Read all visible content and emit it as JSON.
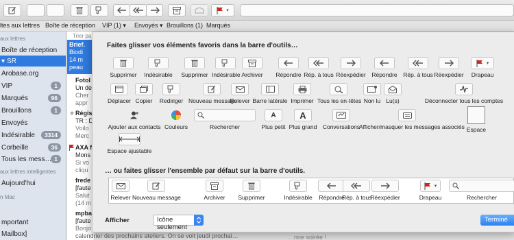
{
  "toolbar": {
    "buttons": [
      {
        "icon": "compose-icon"
      },
      {
        "icon": "blank"
      },
      {
        "icon": "blank"
      },
      {
        "icon": "trash-icon"
      },
      {
        "icon": "thumbs-down-icon"
      },
      {
        "icon": "reply-icon"
      },
      {
        "icon": "reply-all-icon"
      },
      {
        "icon": "forward-icon"
      },
      {
        "icon": "archive-icon"
      },
      {
        "icon": "mailbox-icon"
      },
      {
        "icon": "flag-icon"
      }
    ]
  },
  "favorites": {
    "items": [
      "ltes aux lettres",
      "Boîte de réception",
      "VIP (1)",
      "Envoyés",
      "Brouillons (1)",
      "Marqués"
    ],
    "vip_chevron": "▾",
    "envoyes_chevron": "▾"
  },
  "sidebar": {
    "header1": "aux lettres",
    "items": [
      {
        "label": "Boîte de réception",
        "badge": ""
      },
      {
        "label": "SR",
        "badge": "",
        "selected": true
      },
      {
        "label": "Arobase.org",
        "badge": ""
      },
      {
        "label": "VIP",
        "badge": "1"
      },
      {
        "label": "Marqués",
        "badge": "96"
      },
      {
        "label": "Brouillons",
        "badge": "1"
      },
      {
        "label": "Envoyés",
        "badge": ""
      },
      {
        "label": "Indésirable",
        "badge": "3314"
      },
      {
        "label": "Corbeille",
        "badge": "36"
      },
      {
        "label": "Tous les mess…",
        "badge": "1"
      }
    ],
    "header2": "aux lettres intelligentes",
    "smart": "Aujourd'hui",
    "header3": "n Mac",
    "mac": [
      "mportant",
      "Mailbox]"
    ]
  },
  "list": {
    "sort": "Trier pa",
    "rows": [
      {
        "l1": "Brief.",
        "l2": "Biodi",
        "l3": "14 m",
        "l4": "peau"
      },
      {
        "l1": "Fotol",
        "l2": "Un de",
        "l3": "Cher",
        "l4": "appr"
      },
      {
        "l1": "Régis",
        "l2": "TR : D",
        "l3": "Voilo",
        "l4": "Merc"
      },
      {
        "l1": "AXA f",
        "l2": "Mons",
        "l3": "Si vo",
        "l4": "cliqu"
      },
      {
        "l1": "frede",
        "l2": "[faute",
        "l3": "Salut",
        "l4": "(14 m"
      },
      {
        "l1": "mpba",
        "l2": "[faute",
        "l3": "Bonjo",
        "l4": ""
      }
    ],
    "footer": "calendrier des prochains ateliers. On se voit jeudi prochai…",
    "bottom": "…nne soirée !"
  },
  "sheet": {
    "title": "Faites glisser vos éléments favoris dans la barre d'outils…",
    "row1": [
      {
        "label": "Supprimer",
        "icon": "trash-icon"
      },
      {
        "label": "Indésirable",
        "icon": "thumbs-down-icon"
      },
      {
        "label": "Supprimer",
        "icon": "trash-icon"
      },
      {
        "label": "Indésirable",
        "icon": "thumbs-down-icon"
      },
      {
        "label": "Archiver",
        "icon": "archive-icon"
      },
      {
        "label": "Répondre",
        "icon": "reply-icon"
      },
      {
        "label": "Rép. à tous",
        "icon": "reply-all-icon"
      },
      {
        "label": "Réexpédier",
        "icon": "forward-icon"
      },
      {
        "label": "Répondre",
        "icon": "reply-icon"
      },
      {
        "label": "Rép. à tous",
        "icon": "reply-all-icon"
      },
      {
        "label": "Réexpédier",
        "icon": "forward-icon"
      },
      {
        "label": "Drapeau",
        "icon": "flag-icon"
      }
    ],
    "row2": [
      {
        "label": "Déplacer",
        "icon": "move-icon"
      },
      {
        "label": "Copier",
        "icon": "copy-icon"
      },
      {
        "label": "Rediriger",
        "icon": "redirect-icon"
      },
      {
        "label": "Nouveau message",
        "icon": "compose-icon"
      },
      {
        "label": "Relever",
        "icon": "mail-icon"
      },
      {
        "label": "Barre latérale",
        "icon": "sidebar-icon"
      },
      {
        "label": "Imprimer",
        "icon": "printer-icon"
      },
      {
        "label": "Tous les en-têtes",
        "icon": "headers-icon"
      },
      {
        "label": "Non lu",
        "icon": "unread-icon"
      },
      {
        "label": "Lu(s)",
        "icon": "read-icon"
      },
      {
        "label": "Déconnecter tous les comptes",
        "icon": "activity-icon"
      }
    ],
    "row3": [
      {
        "label": "Ajouter aux contacts",
        "icon": "add-contact-icon"
      },
      {
        "label": "Couleurs",
        "icon": "color-wheel-icon"
      },
      {
        "label": "Rechercher",
        "icon": "search-icon"
      },
      {
        "label": "Plus petit",
        "icon": "font-small-icon"
      },
      {
        "label": "Plus grand",
        "icon": "font-large-icon"
      },
      {
        "label": "Conversations",
        "icon": "conversations-icon"
      },
      {
        "label": "Afficher/masquer les messages associés",
        "icon": "related-icon"
      },
      {
        "label": "Espace",
        "icon": "space-icon"
      }
    ],
    "row4": [
      {
        "label": "Espace ajustable",
        "icon": "flexible-space-icon"
      }
    ],
    "default_title": "… ou faites glisser l'ensemble par défaut sur la barre d'outils.",
    "defaults": [
      {
        "label": "Relever",
        "icon": "mail-icon"
      },
      {
        "label": "Nouveau message",
        "icon": "compose-icon"
      },
      {
        "label": "Archiver",
        "icon": "archive-icon"
      },
      {
        "label": "Supprimer",
        "icon": "trash-icon"
      },
      {
        "label": "Indésirable",
        "icon": "thumbs-down-icon"
      },
      {
        "label": "Répondre",
        "icon": "reply-icon"
      },
      {
        "label": "Rép. à tous",
        "icon": "reply-all-icon"
      },
      {
        "label": "Réexpédier",
        "icon": "forward-icon"
      },
      {
        "label": "Drapeau",
        "icon": "flag-icon"
      },
      {
        "label": "Rechercher",
        "icon": "search-icon"
      }
    ],
    "show_label": "Afficher",
    "show_value": "Icône seulement",
    "done": "Terminé"
  },
  "colors": {
    "accent": "#2f7be0",
    "flag": "#c8281e"
  }
}
